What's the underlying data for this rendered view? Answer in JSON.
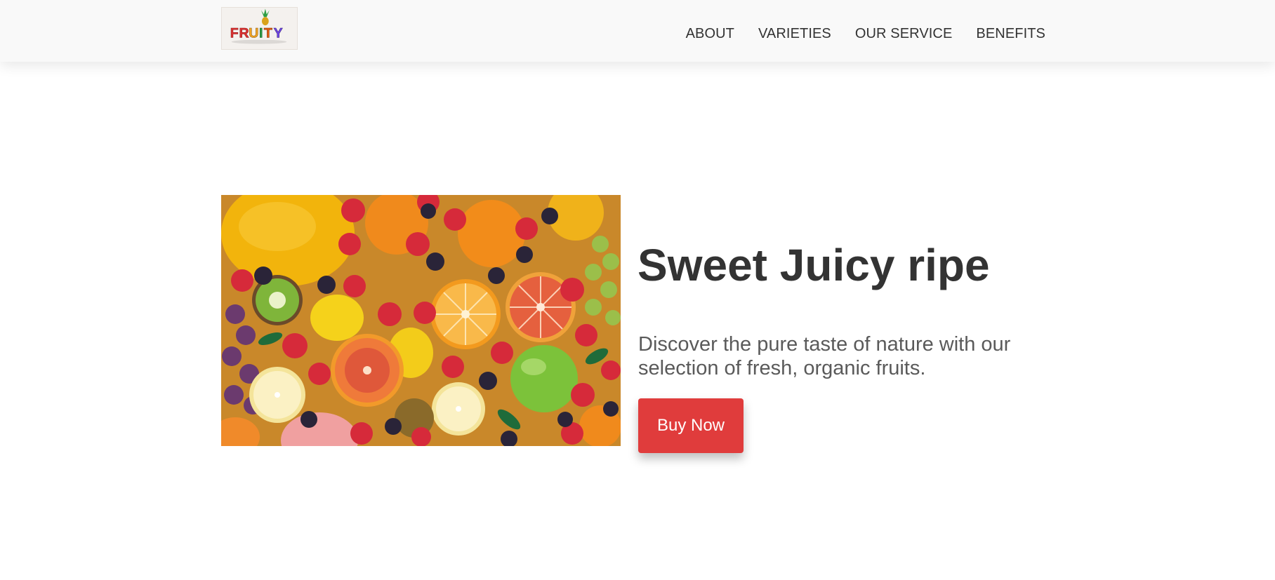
{
  "brand": {
    "logo_text": "FRUITY",
    "colors": [
      "#e03131",
      "#f5a623",
      "#2f9e44",
      "#7048e8",
      "#e8590c",
      "#1971c2"
    ]
  },
  "nav": {
    "items": [
      {
        "label": "ABOUT"
      },
      {
        "label": "VARIETIES"
      },
      {
        "label": "OUR SERVICE"
      },
      {
        "label": "BENEFITS"
      }
    ]
  },
  "hero": {
    "title": "Sweet Juicy ripe",
    "description": "Discover the pure taste of nature with our selection of fresh, organic fruits.",
    "button_label": "Buy Now",
    "image_icon": "mixed-fruits-image"
  },
  "colors": {
    "header_bg": "#f9f9f9",
    "text_dark": "#333333",
    "text_muted": "#5a5a5a",
    "accent": "#e03c3c"
  }
}
